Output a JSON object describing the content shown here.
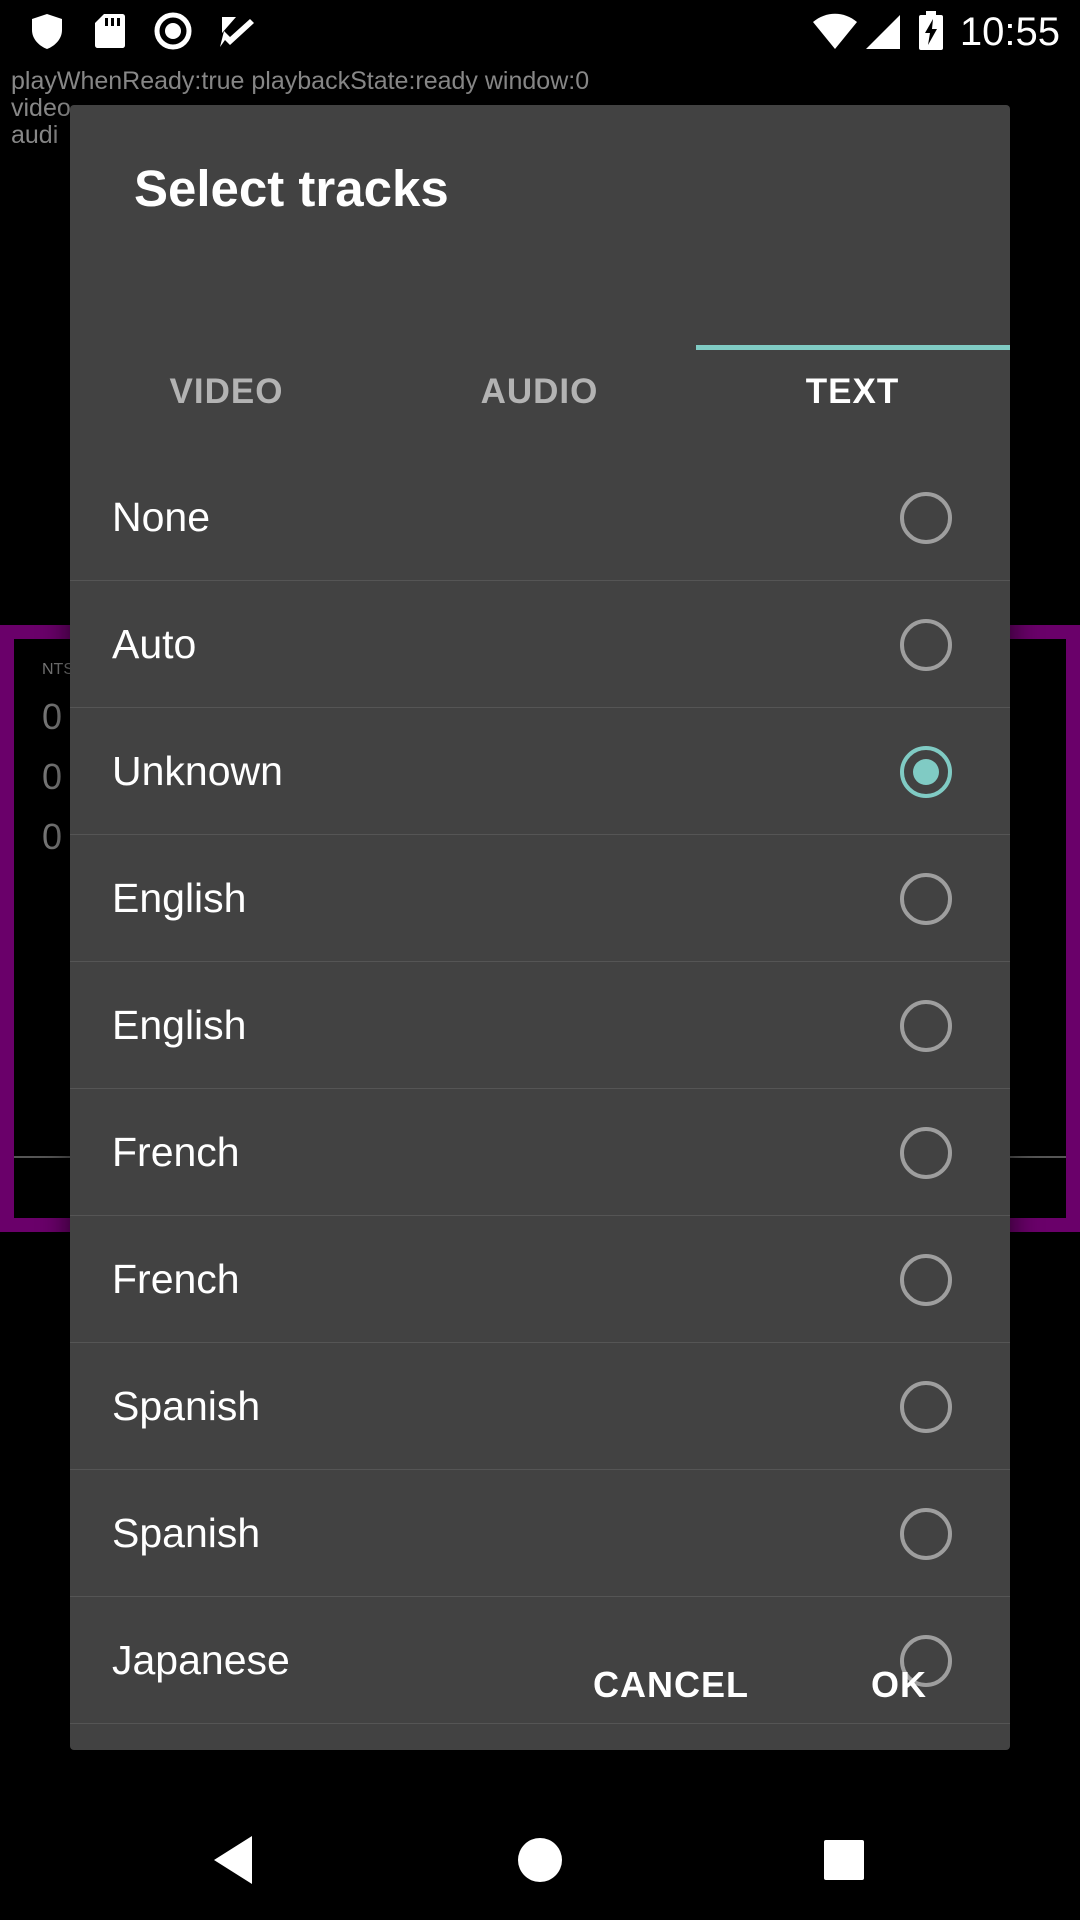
{
  "status_bar": {
    "time": "10:55",
    "left_icons": [
      "shield-icon",
      "sd-card-icon",
      "record-icon",
      "check-notification-icon"
    ],
    "right_icons": [
      "wifi-icon",
      "signal-icon",
      "battery-charging-icon"
    ]
  },
  "player_debug": {
    "line1": "playWhenReady:true playbackState:ready window:0",
    "line2": "video",
    "line3": "audi"
  },
  "video_overlay": {
    "label": "NTS",
    "digit_rows": [
      "0",
      "0",
      "0"
    ]
  },
  "dialog": {
    "title": "Select tracks",
    "tabs": [
      {
        "label": "VIDEO",
        "active": false
      },
      {
        "label": "AUDIO",
        "active": false
      },
      {
        "label": "TEXT",
        "active": true
      }
    ],
    "accent_color": "#80cbc4",
    "tracks": [
      {
        "label": "None",
        "selected": false
      },
      {
        "label": "Auto",
        "selected": false
      },
      {
        "label": "Unknown",
        "selected": true
      },
      {
        "label": "English",
        "selected": false
      },
      {
        "label": "English",
        "selected": false
      },
      {
        "label": "French",
        "selected": false
      },
      {
        "label": "French",
        "selected": false
      },
      {
        "label": "Spanish",
        "selected": false
      },
      {
        "label": "Spanish",
        "selected": false
      },
      {
        "label": "Japanese",
        "selected": false
      }
    ],
    "cancel_label": "CANCEL",
    "ok_label": "OK"
  },
  "nav_bar": {
    "buttons": [
      "back-icon",
      "home-icon",
      "recents-icon"
    ]
  }
}
